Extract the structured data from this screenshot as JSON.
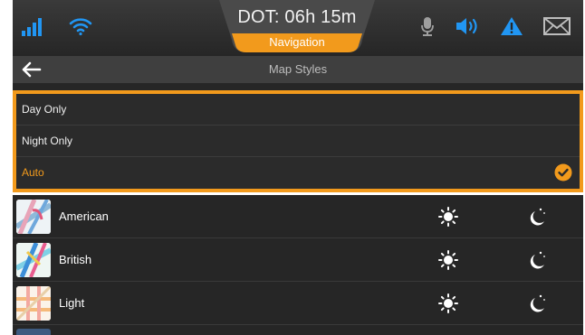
{
  "status_bar": {
    "dot_text": "DOT: 06h 15m",
    "nav_badge": "Navigation",
    "icons": [
      "signal-bars-icon",
      "wifi-icon",
      "microphone-icon",
      "speaker-icon",
      "warning-icon",
      "mail-icon"
    ],
    "colors": {
      "accent": "#f29a1c",
      "blue": "#2196f3"
    }
  },
  "header": {
    "title": "Map Styles"
  },
  "modes": [
    {
      "label": "Day Only",
      "selected": false
    },
    {
      "label": "Night Only",
      "selected": false
    },
    {
      "label": "Auto",
      "selected": true
    }
  ],
  "styles": [
    {
      "name": "American"
    },
    {
      "name": "British"
    },
    {
      "name": "Light"
    }
  ]
}
